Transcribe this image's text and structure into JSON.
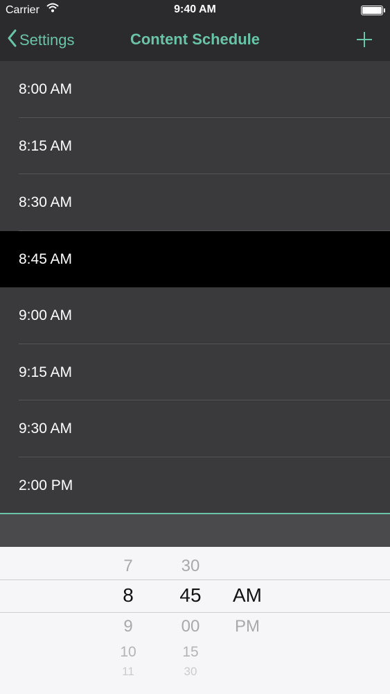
{
  "status_bar": {
    "carrier": "Carrier",
    "time": "9:40 AM"
  },
  "nav": {
    "back_label": "Settings",
    "title": "Content Schedule"
  },
  "times": [
    {
      "label": "8:00 AM",
      "selected": false
    },
    {
      "label": "8:15 AM",
      "selected": false
    },
    {
      "label": "8:30 AM",
      "selected": false
    },
    {
      "label": "8:45 AM",
      "selected": true
    },
    {
      "label": "9:00 AM",
      "selected": false
    },
    {
      "label": "9:15 AM",
      "selected": false
    },
    {
      "label": "9:30 AM",
      "selected": false
    },
    {
      "label": "2:00 PM",
      "selected": false
    }
  ],
  "picker": {
    "hours": [
      "7",
      "8",
      "9",
      "10",
      "11"
    ],
    "minutes": [
      "30",
      "45",
      "00",
      "15",
      "30"
    ],
    "periods": [
      "AM",
      "PM"
    ],
    "selected": {
      "hour": "8",
      "minute": "45",
      "period": "AM"
    }
  },
  "colors": {
    "accent": "#6ac4a6",
    "nav_bg": "#2b2a2d",
    "list_bg": "#3a393b",
    "selected_row_bg": "#000000"
  }
}
